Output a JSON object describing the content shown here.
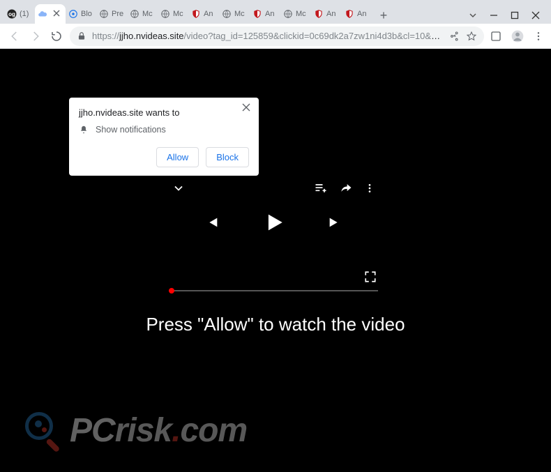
{
  "window": {
    "tabs": [
      {
        "favicon": "og",
        "title": "(1)",
        "active": false
      },
      {
        "favicon": "cloud",
        "title": "",
        "active": true
      },
      {
        "favicon": "globe-blue",
        "title": "Blo",
        "active": false
      },
      {
        "favicon": "globe",
        "title": "Pre",
        "active": false
      },
      {
        "favicon": "globe",
        "title": "Mc",
        "active": false
      },
      {
        "favicon": "globe",
        "title": "Mc",
        "active": false
      },
      {
        "favicon": "shield",
        "title": "An",
        "active": false
      },
      {
        "favicon": "globe",
        "title": "Mc",
        "active": false
      },
      {
        "favicon": "shield",
        "title": "An",
        "active": false
      },
      {
        "favicon": "globe",
        "title": "Mc",
        "active": false
      },
      {
        "favicon": "shield",
        "title": "An",
        "active": false
      },
      {
        "favicon": "shield",
        "title": "An",
        "active": false
      }
    ],
    "new_tab": "+"
  },
  "toolbar": {
    "url_prefix": "https://",
    "url_host": "jjho.nvideas.site",
    "url_path": "/video?tag_id=125859&clickid=0c69dk2a7zw1ni4d3b&cl=10&dp=https%3A..."
  },
  "notification": {
    "host_wants_to": "jjho.nvideas.site wants to",
    "show_notifications": "Show notifications",
    "allow": "Allow",
    "block": "Block"
  },
  "page": {
    "instruction": "Press \"Allow\" to watch the video"
  },
  "watermark": {
    "pc": "PC",
    "risk": "risk",
    "dot": ".",
    "com": "com"
  }
}
